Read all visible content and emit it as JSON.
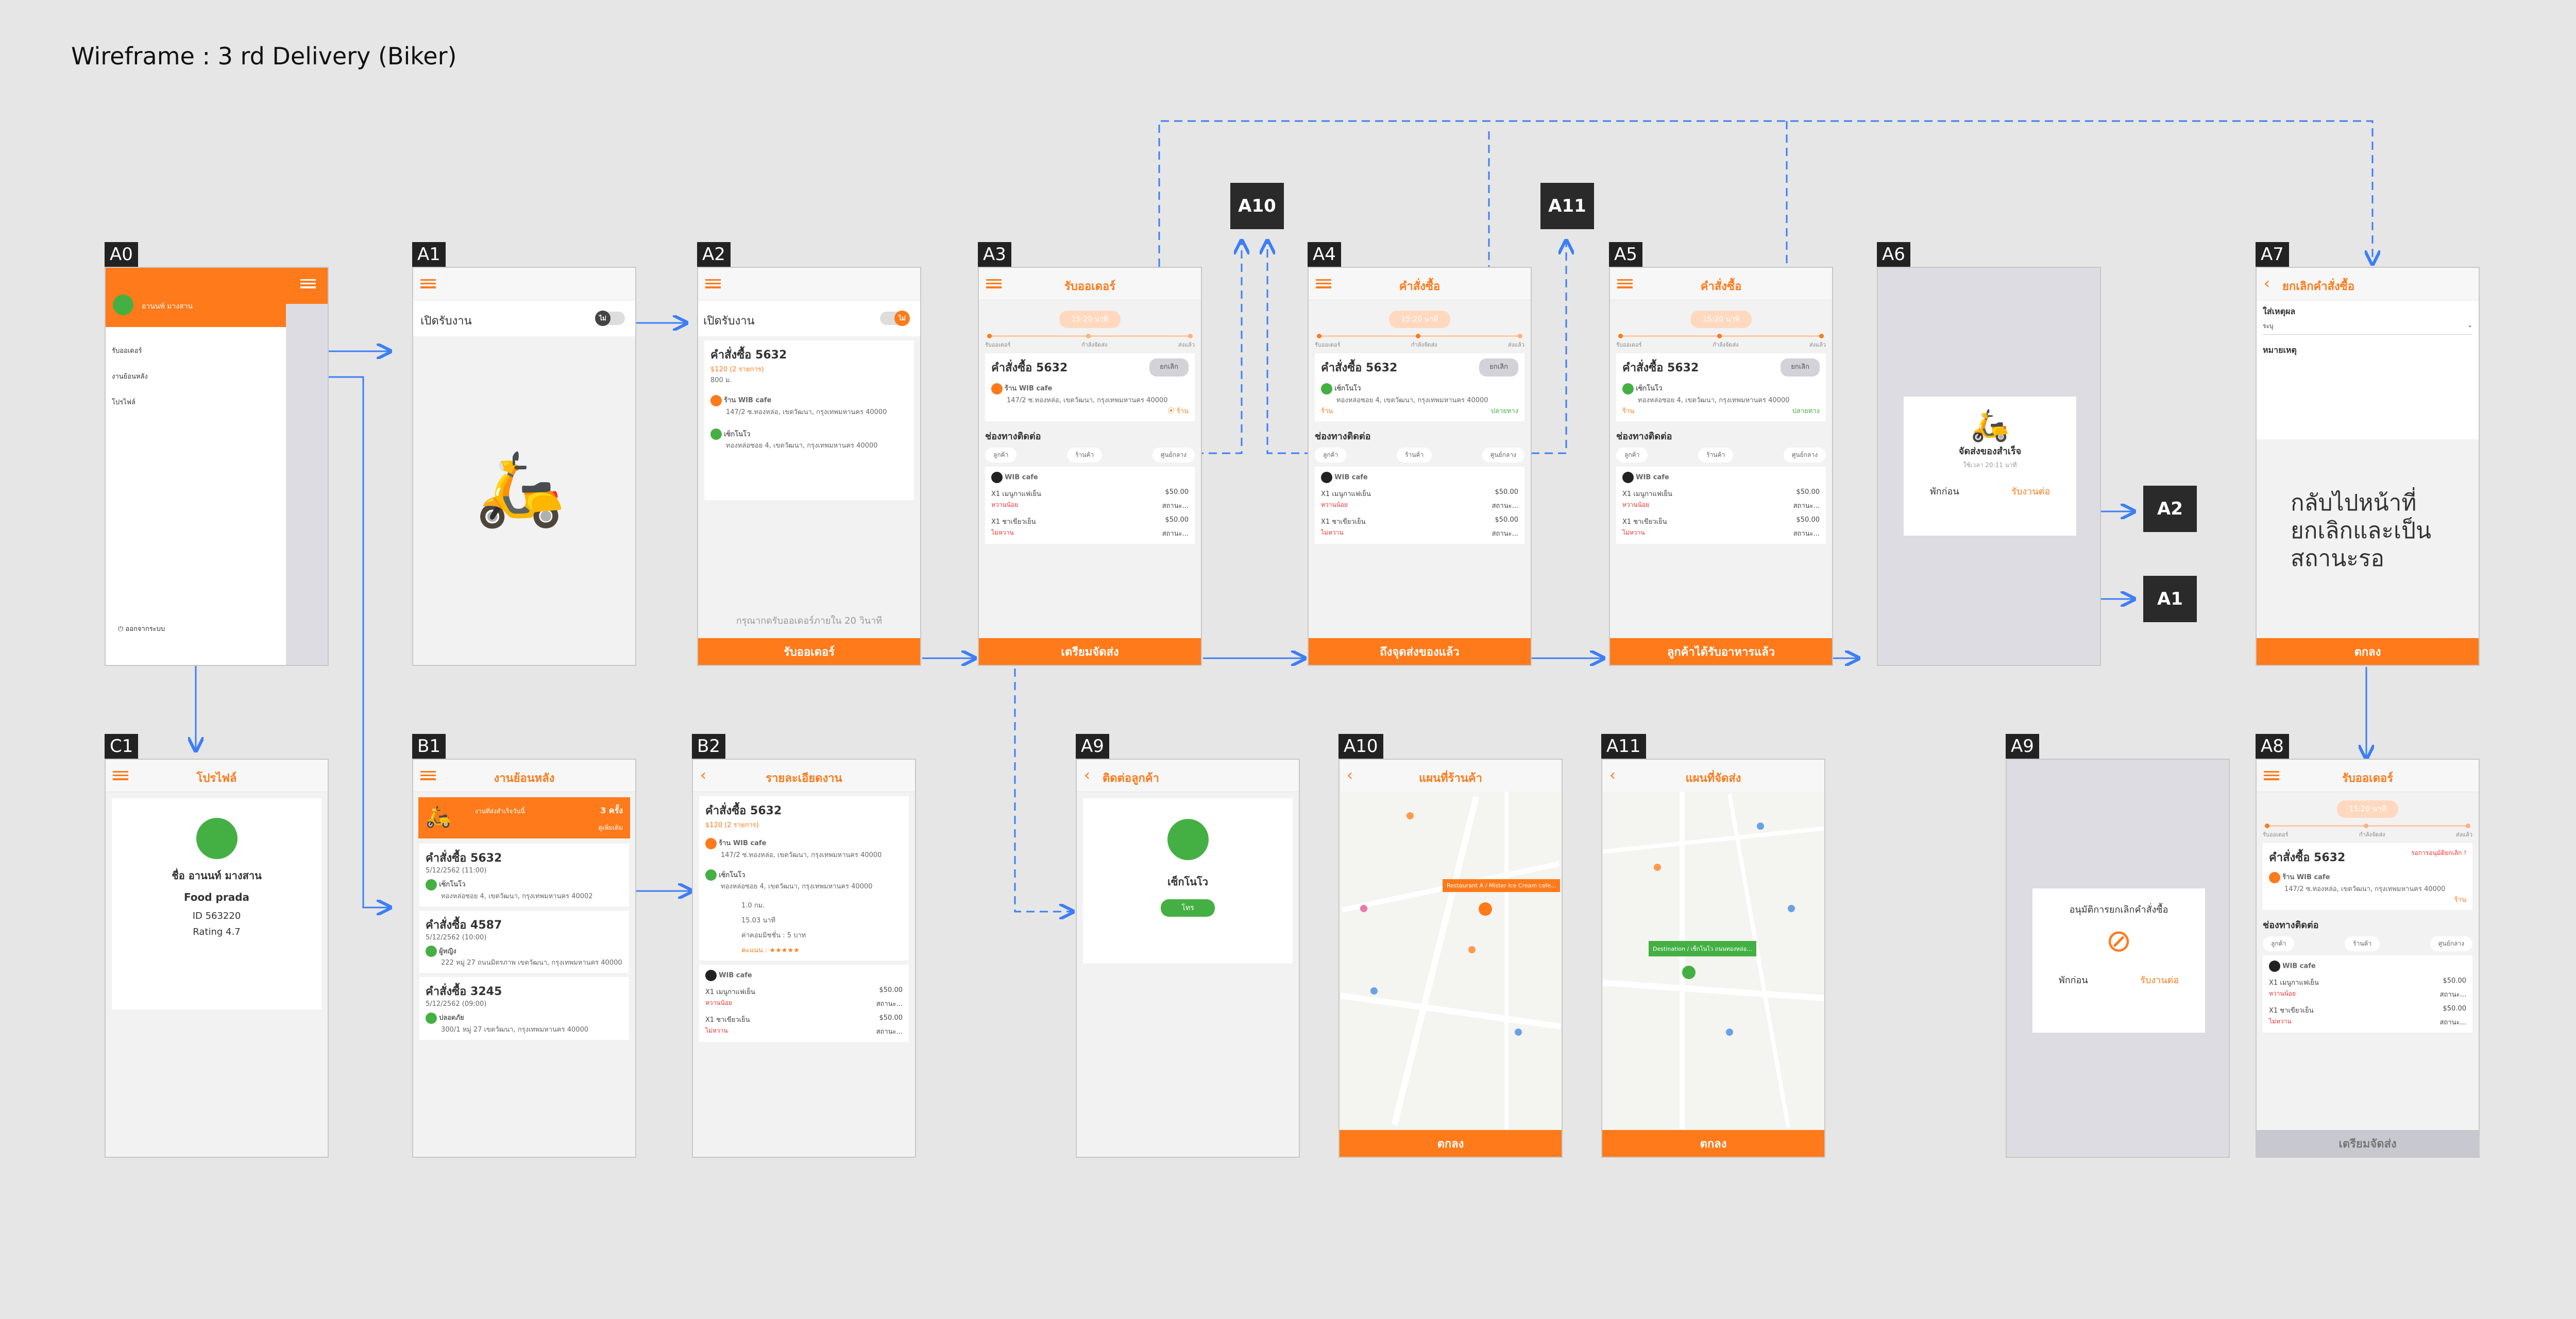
{
  "title": "Wireframe : 3 rd Delivery (Biker)",
  "labels": {
    "A0": "A0",
    "A1": "A1",
    "A2": "A2",
    "A3": "A3",
    "A4": "A4",
    "A5": "A5",
    "A6": "A6",
    "A7": "A7",
    "C1": "C1",
    "B1": "B1",
    "B2": "B2",
    "A9": "A9",
    "A10": "A10",
    "A11": "A11",
    "A8": "A8"
  },
  "boxes": {
    "a10": "A10",
    "a11": "A11",
    "a2": "A2",
    "a1": "A1"
  },
  "a0": {
    "username": "อานนท์ มางสาน",
    "menu": [
      "รับออเดอร์",
      "งานย้อนหลัง",
      "โปรไฟล์"
    ],
    "logout": "ออกจากระบบ"
  },
  "a1": {
    "toggle_label": "เปิดรับงาน",
    "toggle_val": "ไม่"
  },
  "a2": {
    "toggle_label": "เปิดรับงาน",
    "toggle_val": "ไม่",
    "order": "คำสั่งซื้อ 5632",
    "price": "$120 (2 รายการ)",
    "dist": "800 ม.",
    "shop": "ร้าน WIB cafe",
    "shop_addr": "147/2 ซ.ทองหล่อ, เขตวัฒนา, กรุงเทพมหานคร 40000",
    "cust": "เซ็กโนโว",
    "cust_addr": "ทองหล่อซอย 4, เขตวัฒนา, กรุงเทพมหานคร 40000",
    "wait": "กรุณากดรับออเดอร์ภายใน 20 วินาที",
    "btn": "รับออเดอร์"
  },
  "a3": {
    "title": "รับออเดอร์",
    "time": "15:20 นาที",
    "steps": [
      "รับออเดอร์",
      "กำลังจัดส่ง",
      "ส่งแล้ว"
    ],
    "order": "คำสั่งซื้อ 5632",
    "cancel": "ยกเลิก",
    "shop": "ร้าน WIB cafe",
    "shop_addr": "147/2 ซ.ทองหล่อ, เขตวัฒนา, กรุงเทพมหานคร 40000",
    "map": "ร้าน",
    "contact": "ช่องทางติดต่อ",
    "chips": [
      "ลูกค้า",
      "ร้านค้า",
      "ศูนย์กลาง"
    ],
    "store": "WIB cafe",
    "item1": "X1 เมนูกาแฟเย็น",
    "price1": "$50.00",
    "note1": "หวานน้อย",
    "status1": "สถานะ...",
    "item2": "X1 ชาเขียวเย็น",
    "price2": "$50.00",
    "note2": "ไม่หวาน",
    "status2": "สถานะ...",
    "btn": "เตรียมจัดส่ง"
  },
  "a4": {
    "title": "คำสั่งซื้อ",
    "time": "15:20 นาที",
    "steps": [
      "รับออเดอร์",
      "กำลังจัดส่ง",
      "ส่งแล้ว"
    ],
    "order": "คำสั่งซื้อ 5632",
    "cancel": "ยกเลิก",
    "cust": "เซ็กโนโว",
    "cust_addr": "ทองหล่อซอย 4, เขตวัฒนา, กรุงเทพมหานคร 40000",
    "map_a": "ร้าน",
    "map_b": "ปลายทาง",
    "contact": "ช่องทางติดต่อ",
    "chips": [
      "ลูกค้า",
      "ร้านค้า",
      "ศูนย์กลาง"
    ],
    "store": "WIB cafe",
    "item1": "X1 เมนูกาแฟเย็น",
    "price1": "$50.00",
    "note1": "หวานน้อย",
    "status1": "สถานะ...",
    "item2": "X1 ชาเขียวเย็น",
    "price2": "$50.00",
    "note2": "ไม่หวาน",
    "status2": "สถานะ...",
    "btn": "ถึงจุดส่งของแล้ว"
  },
  "a5": {
    "title": "คำสั่งซื้อ",
    "time": "15:20 นาที",
    "steps": [
      "รับออเดอร์",
      "กำลังจัดส่ง",
      "ส่งแล้ว"
    ],
    "order": "คำสั่งซื้อ 5632",
    "cancel": "ยกเลิก",
    "cust": "เซ็กโนโว",
    "cust_addr": "ทองหล่อซอย 4, เขตวัฒนา, กรุงเทพมหานคร 40000",
    "map_a": "ร้าน",
    "map_b": "ปลายทาง",
    "contact": "ช่องทางติดต่อ",
    "chips": [
      "ลูกค้า",
      "ร้านค้า",
      "ศูนย์กลาง"
    ],
    "store": "WIB cafe",
    "item1": "X1 เมนูกาแฟเย็น",
    "price1": "$50.00",
    "note1": "หวานน้อย",
    "status1": "สถานะ...",
    "item2": "X1 ชาเขียวเย็น",
    "price2": "$50.00",
    "note2": "ไม่หวาน",
    "status2": "สถานะ...",
    "btn": "ลูกค้าได้รับอาหารแล้ว"
  },
  "a6": {
    "title": "จัดส่งของสำเร็จ",
    "sub": "ใช้เวลา 20:11 นาที",
    "rest": "พักก่อน",
    "accept": "รับงานต่อ"
  },
  "a7": {
    "title": "ยกเลิกคำสั่งซื้อ",
    "reason": "ใส่เหตุผล",
    "reason_val": "ระบุ",
    "note": "หมายเหตุ",
    "big": "กลับไปหน้าที่ยกเลิกและเป็นสถานะรอ",
    "btn": "ตกลง"
  },
  "c1": {
    "title": "โปรไฟล์",
    "name": "ชื่อ อานนท์ มางสาน",
    "shop": "Food prada",
    "id": "ID 563220",
    "rating": "Rating  4.7"
  },
  "b1": {
    "title": "งานย้อนหลัง",
    "banner": "งานที่ส่งสำเร็จวันนี้",
    "banner_count": "3 ครั้ง",
    "banner_more": "ดูเพิ่มเติม",
    "orders": [
      {
        "no": "คำสั่งซื้อ 5632",
        "date": "5/12/2562 (11:00)",
        "who": "เซ็กโนโว",
        "addr": "ทองหล่อซอย 4, เขตวัฒนา, กรุงเทพมหานคร 40002"
      },
      {
        "no": "คำสั่งซื้อ 4587",
        "date": "5/12/2562 (10:00)",
        "who": "ผู้หญิง",
        "addr": "222 หมู่ 27 ถนนมิตรภาพ เขตวัฒนา, กรุงเทพมหานคร 40000"
      },
      {
        "no": "คำสั่งซื้อ 3245",
        "date": "5/12/2562 (09:00)",
        "who": "ปลอดภัย",
        "addr": "300/1 หมู่ 27 เขตวัฒนา, กรุงเทพมหานคร 40000"
      }
    ]
  },
  "b2": {
    "title": "รายละเอียดงาน",
    "order": "คำสั่งซื้อ 5632",
    "price": "$120 (2 รายการ)",
    "shop": "ร้าน WIB cafe",
    "shop_addr": "147/2 ซ.ทองหล่อ, เขตวัฒนา, กรุงเทพมหานคร 40000",
    "cust": "เซ็กโนโว",
    "cust_addr": "ทองหล่อซอย 4, เขตวัฒนา, กรุงเทพมหานคร 40000",
    "dist": "1.0 กม.",
    "time": "15.03 นาที",
    "fee": "ค่าคอมมิชชั่น : 5 บาท",
    "score": "คะแนน : ★★★★★",
    "store": "WIB cafe",
    "item1": "X1 เมนูกาแฟเย็น",
    "price1": "$50.00",
    "note1": "หวานน้อย",
    "status1": "สถานะ...",
    "item2": "X1 ชาเขียวเย็น",
    "price2": "$50.00",
    "note2": "ไม่หวาน",
    "status2": "สถานะ..."
  },
  "a9a": {
    "title": "ติดต่อลูกค้า",
    "name": "เซ็กโนโว",
    "call": "โทร"
  },
  "a10": {
    "title": "แผนที่ร้านค้า",
    "callout": "Restaurant A / Mister Ice Cream cafe...",
    "btn": "ตกลง"
  },
  "a11": {
    "title": "แผนที่จัดส่ง",
    "callout": "Destination / เซ็กโนโว ถนนทองหล่อ...",
    "btn": "ตกลง"
  },
  "a9b": {
    "title": "อนุมัติการยกเลิกคำสั่งซื้อ",
    "rest": "พักก่อน",
    "accept": "รับงานต่อ"
  },
  "a8": {
    "title": "รับออเดอร์",
    "time": "15:20 นาที",
    "steps": [
      "รับออเดอร์",
      "กำลังจัดส่ง",
      "ส่งแล้ว"
    ],
    "order": "คำสั่งซื้อ 5632",
    "cancel_req": "รอการอนุมัติยกเลิก !",
    "shop": "ร้าน WIB cafe",
    "shop_addr": "147/2 ซ.ทองหล่อ, เขตวัฒนา, กรุงเทพมหานคร 40000",
    "map": "ร้าน",
    "contact": "ช่องทางติดต่อ",
    "chips": [
      "ลูกค้า",
      "ร้านค้า",
      "ศูนย์กลาง"
    ],
    "store": "WIB cafe",
    "item1": "X1 เมนูกาแฟเย็น",
    "price1": "$50.00",
    "note1": "หวานน้อย",
    "status1": "สถานะ...",
    "item2": "X1 ชาเขียวเย็น",
    "price2": "$50.00",
    "note2": "ไม่หวาน",
    "status2": "สถานะ...",
    "btn": "เตรียมจัดส่ง"
  },
  "colors": {
    "accent": "#ff7a1a",
    "green": "#44b044",
    "link": "#3d7ef5",
    "frame_bg": "#f2f2f2"
  }
}
